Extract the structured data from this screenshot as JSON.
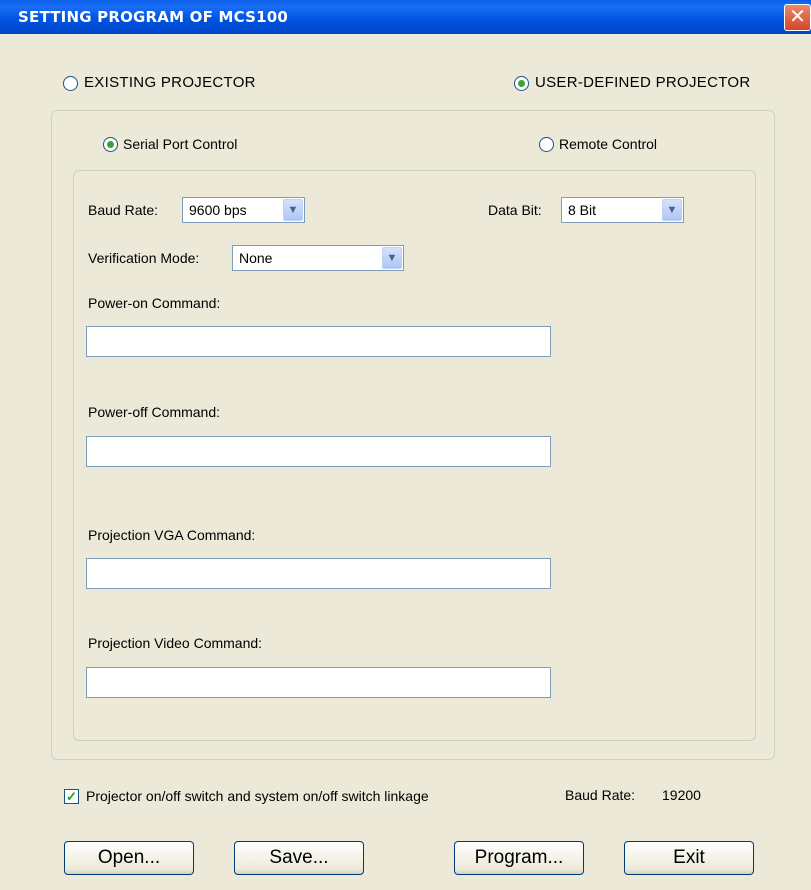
{
  "window": {
    "title": "SETTING PROGRAM OF MCS100"
  },
  "projector_type": {
    "existing_label": "EXISTING PROJECTOR",
    "existing_selected": false,
    "user_defined_label": "USER-DEFINED PROJECTOR",
    "user_defined_selected": true
  },
  "control_mode": {
    "serial_label": "Serial Port Control",
    "serial_selected": true,
    "remote_label": "Remote Control",
    "remote_selected": false
  },
  "serial_settings": {
    "baud_rate_label": "Baud Rate:",
    "baud_rate_value": "9600 bps",
    "data_bit_label": "Data Bit:",
    "data_bit_value": "8 Bit",
    "verification_label": "Verification Mode:",
    "verification_value": "None"
  },
  "commands": {
    "power_on_label": "Power-on Command:",
    "power_on_value": "",
    "power_off_label": "Power-off Command:",
    "power_off_value": "",
    "vga_label": "Projection VGA Command:",
    "vga_value": "",
    "video_label": "Projection Video Command:",
    "video_value": ""
  },
  "footer": {
    "linkage_label": "Projector on/off switch and system on/off switch linkage",
    "linkage_checked": true,
    "baud_rate_label": "Baud Rate:",
    "baud_rate_value": "19200"
  },
  "buttons": {
    "open": "Open...",
    "save": "Save...",
    "program": "Program...",
    "exit": "Exit"
  },
  "icons": {
    "close": "close-icon",
    "dropdown": "chevron-down-icon",
    "check": "checkmark-icon"
  }
}
